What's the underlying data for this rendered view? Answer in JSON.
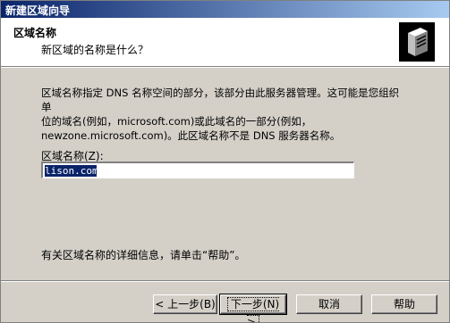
{
  "window": {
    "title": "新建区域向导"
  },
  "header": {
    "title": "区域名称",
    "subtitle": "新区域的名称是什么？",
    "icon": "server-icon"
  },
  "body": {
    "description_line1": "区域名称指定 DNS 名称空间的部分，该部分由此服务器管理。这可能是您组织单",
    "description_line2": "位的域名(例如，microsoft.com)或此域名的一部分(例如，",
    "description_line3": "newzone.microsoft.com)。此区域名称不是 DNS 服务器名称。",
    "zone_name_label": "区域名称(Z):",
    "zone_name_value": "lison.com",
    "help_hint": "有关区域名称的详细信息，请单击“帮助”。"
  },
  "buttons": {
    "back": "< 上一步(B)",
    "next": "下一步(N) >",
    "cancel": "取消",
    "help": "帮助"
  },
  "colors": {
    "title_bar_start": "#0a246a",
    "title_bar_end": "#a6caf0",
    "dialog_face": "#d4d0c8",
    "selection": "#0a246a"
  }
}
